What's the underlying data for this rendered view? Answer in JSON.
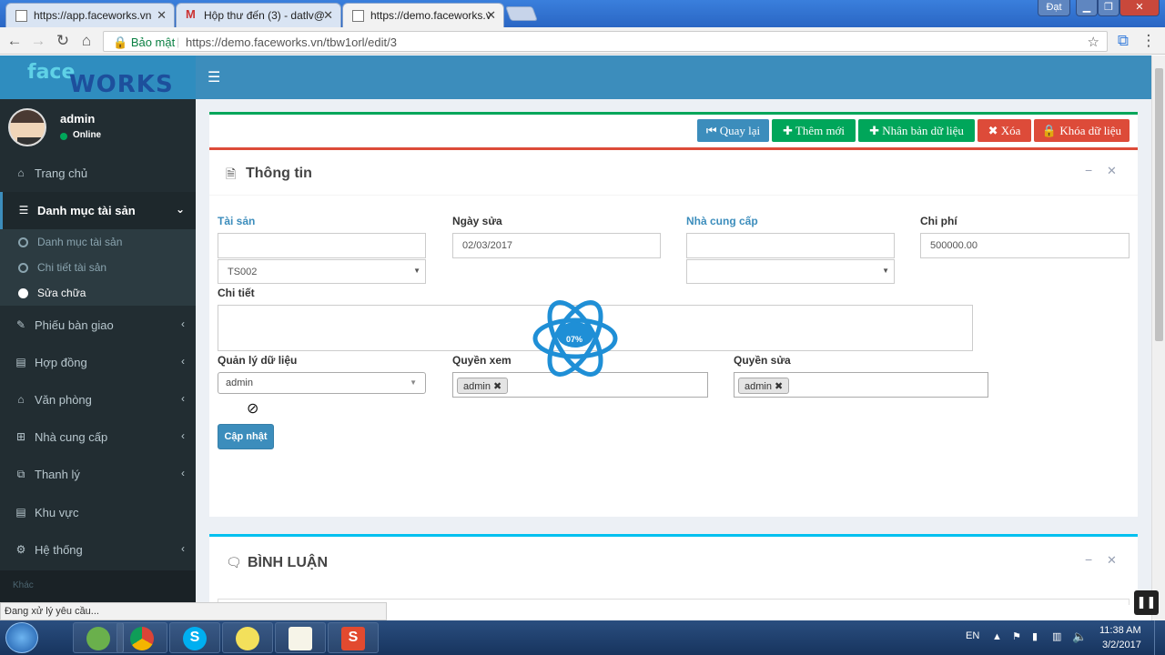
{
  "browser": {
    "tabs": [
      {
        "label": "https://app.faceworks.vn"
      },
      {
        "label": "Hộp thư đến (3) - datlv@"
      },
      {
        "label": "https://demo.faceworks.v"
      }
    ],
    "user_badge": "Đạt",
    "secure_label": "Bảo mật",
    "url": "https://demo.faceworks.vn/tbw1orl/edit/3"
  },
  "app": {
    "logo_face": "face",
    "logo_works": "WORKS",
    "menu_icon": "hamburger-icon"
  },
  "user": {
    "name": "admin",
    "status": "Online"
  },
  "sidebar": {
    "items": [
      {
        "label": "Trang chủ",
        "icon": "home-icon"
      },
      {
        "label": "Danh mục tài sản",
        "icon": "list-icon"
      },
      {
        "label": "Phiếu bàn giao",
        "icon": "edit-icon"
      },
      {
        "label": "Hợp đồng",
        "icon": "book-icon"
      },
      {
        "label": "Văn phòng",
        "icon": "bank-icon"
      },
      {
        "label": "Nhà cung cấp",
        "icon": "cart-icon"
      },
      {
        "label": "Thanh lý",
        "icon": "external-icon"
      },
      {
        "label": "Khu vực",
        "icon": "book-icon"
      },
      {
        "label": "Hệ thống",
        "icon": "gears-icon"
      }
    ],
    "subitems": [
      {
        "label": "Danh mục tài sản"
      },
      {
        "label": "Chi tiết tài sản"
      },
      {
        "label": "Sửa chữa"
      }
    ],
    "footer_header": "Khác"
  },
  "toolbar": {
    "back": "Quay lại",
    "add": "Thêm mới",
    "duplicate": "Nhân bản dữ liệu",
    "delete": "Xóa",
    "lock": "Khóa dữ liệu"
  },
  "form": {
    "title": "Thông tin",
    "asset_label": "Tài sản",
    "asset_input": "",
    "asset_select": "TS002",
    "date_label": "Ngày sửa",
    "date_value": "02/03/2017",
    "supplier_label": "Nhà cung cấp",
    "supplier_input": "",
    "supplier_select": "",
    "cost_label": "Chi phí",
    "cost_value": "500000.00",
    "detail_label": "Chi tiết",
    "detail_value": "",
    "manager_label": "Quản lý dữ liệu",
    "manager_value": "admin",
    "view_label": "Quyền xem",
    "view_tag": "admin",
    "edit_label": "Quyền sửa",
    "edit_tag": "admin",
    "submit": "Cập nhật",
    "loading_text": "07%"
  },
  "comments": {
    "title": "BÌNH LUẬN"
  },
  "statusbar": {
    "text": "Đang xử lý yêu cầu..."
  },
  "taskbar": {
    "lang": "EN",
    "time": "11:38 AM",
    "date": "3/2/2017"
  },
  "colors": {
    "header": "#3c8dbc",
    "sidebar": "#222d32",
    "btn_back": "#3c8dbc",
    "btn_green": "#00a65a",
    "btn_red": "#dd4b39"
  }
}
